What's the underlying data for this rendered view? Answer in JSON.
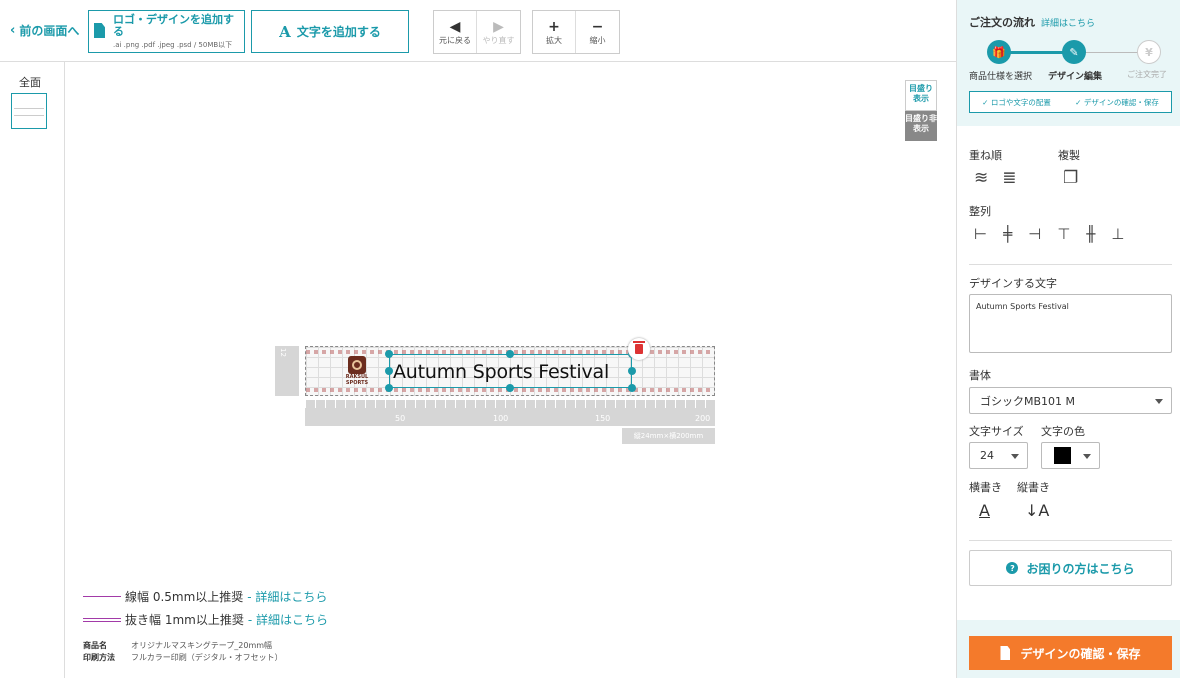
{
  "toolbar": {
    "back_label": "前の画面へ",
    "add_logo_label": "ロゴ・デザインを追加する",
    "add_logo_formats": ".ai .png .pdf .jpeg .psd / 50MB以下",
    "add_text_label": "文字を追加する",
    "undo_label": "元に戻る",
    "redo_label": "やり直す",
    "zoom_in_label": "拡大",
    "zoom_out_label": "縮小"
  },
  "sidebar": {
    "all_label": "全面"
  },
  "canvas": {
    "grid_on_label": "目盛り表示",
    "grid_off_label": "目盛り非表示",
    "design_text": "Autumn Sports Festival",
    "logo_text": "RAKSUL SPORTS",
    "ruler_vertical": "12",
    "ruler_ticks": [
      "50",
      "100",
      "150",
      "200"
    ],
    "size_tag": "縦24mm×横200mm"
  },
  "legend": {
    "line_width": "線幅 0.5mm以上推奨",
    "knockout_width": "抜き幅 1mm以上推奨",
    "details_link": "- 詳細はこちら"
  },
  "product": {
    "name_label": "商品名",
    "name_value": "オリジナルマスキングテープ_20mm幅",
    "print_label": "印刷方法",
    "print_value": "フルカラー印刷（デジタル・オフセット）"
  },
  "panel": {
    "flow_title": "ご注文の流れ",
    "flow_details": "詳細はこちら",
    "step1": "商品仕様を選択",
    "step2": "デザイン編集",
    "step3": "ご注文完了",
    "substep1": "✓ ロゴや文字の配置",
    "substep2": "✓ デザインの確認・保存",
    "layer_label": "重ね順",
    "duplicate_label": "複製",
    "align_label": "整列",
    "design_text_label": "デザインする文字",
    "design_text_value": "Autumn Sports Festival",
    "font_label": "書体",
    "font_value": "ゴシックMB101 M",
    "size_label": "文字サイズ",
    "size_value": "24",
    "color_label": "文字の色",
    "text_color": "#000000",
    "horizontal_label": "横書き",
    "vertical_label": "縦書き",
    "help_label": "お困りの方はこちら",
    "confirm_label": "デザインの確認・保存"
  },
  "colors": {
    "accent": "#1b9aaa",
    "cta": "#f47a2b"
  }
}
